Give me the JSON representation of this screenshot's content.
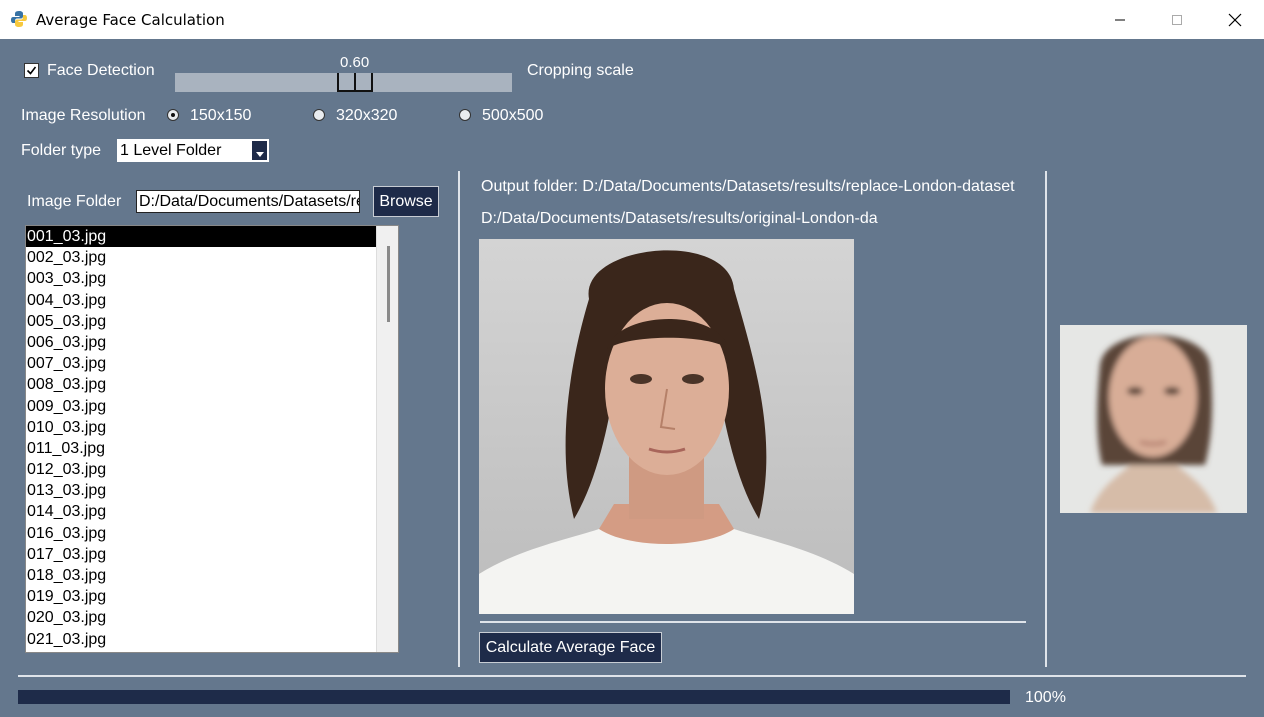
{
  "window": {
    "title": "Average Face Calculation"
  },
  "face_detection": {
    "label": "Face Detection",
    "checked": true
  },
  "cropping": {
    "value_text": "0.60",
    "label": "Cropping scale",
    "value": 0.6
  },
  "resolution": {
    "label": "Image Resolution",
    "options": [
      {
        "label": "150x150",
        "selected": true
      },
      {
        "label": "320x320",
        "selected": false
      },
      {
        "label": "500x500",
        "selected": false
      }
    ]
  },
  "folder_type": {
    "label": "Folder type",
    "value": "1 Level Folder"
  },
  "image_folder": {
    "label": "Image Folder",
    "value": "D:/Data/Documents/Datasets/re",
    "browse_label": "Browse"
  },
  "file_list": {
    "items": [
      "001_03.jpg",
      "002_03.jpg",
      "003_03.jpg",
      "004_03.jpg",
      "005_03.jpg",
      "006_03.jpg",
      "007_03.jpg",
      "008_03.jpg",
      "009_03.jpg",
      "010_03.jpg",
      "011_03.jpg",
      "012_03.jpg",
      "013_03.jpg",
      "014_03.jpg",
      "016_03.jpg",
      "017_03.jpg",
      "018_03.jpg",
      "019_03.jpg",
      "020_03.jpg",
      "021_03.jpg"
    ],
    "selected_index": 0
  },
  "output": {
    "folder_text": "Output folder: D:/Data/Documents/Datasets/results/replace-London-dataset",
    "path_text": "D:/Data/Documents/Datasets/results/original-London-da"
  },
  "calculate": {
    "label": "Calculate Average Face"
  },
  "progress": {
    "value": 1.0,
    "text": "100%"
  },
  "colors": {
    "background": "#64778d",
    "accent": "#1e2b49"
  }
}
